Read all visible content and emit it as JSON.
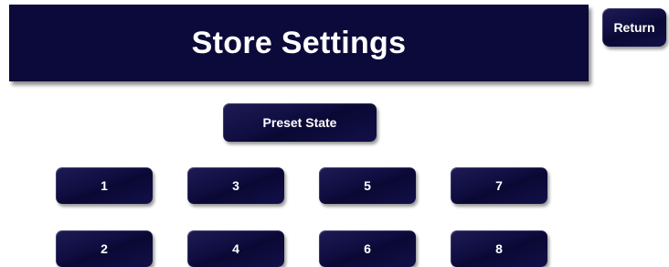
{
  "header": {
    "title": "Store Settings"
  },
  "navigation": {
    "return_label": "Return"
  },
  "preset": {
    "label": "Preset State"
  },
  "preset_buttons": {
    "b1": "1",
    "b2": "2",
    "b3": "3",
    "b4": "4",
    "b5": "5",
    "b6": "6",
    "b7": "7",
    "b8": "8"
  },
  "colors": {
    "button_navy": "#0c0a3a",
    "text": "#ffffff",
    "background": "#ffffff"
  }
}
